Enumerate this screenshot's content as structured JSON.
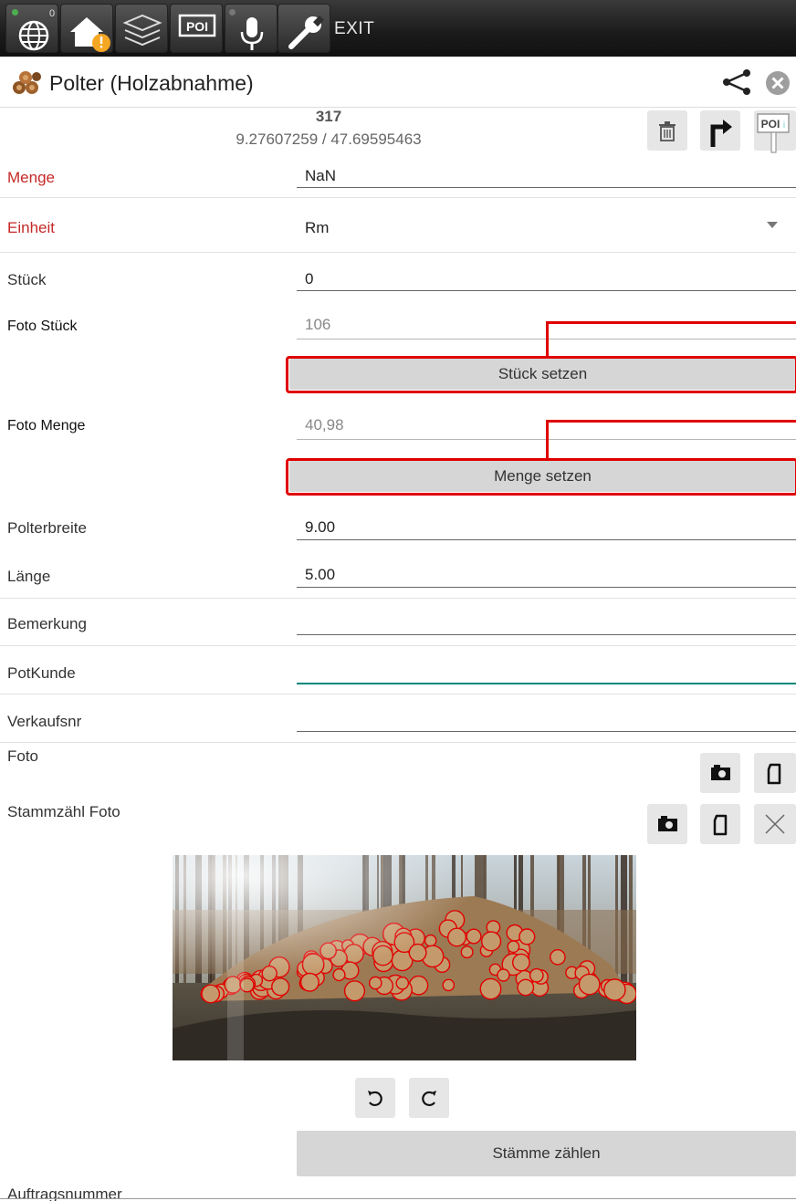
{
  "toolbar": {
    "exit_label": "EXIT",
    "gps_badge": "0",
    "items": [
      "globe-icon",
      "home-warning-icon",
      "layers-icon",
      "poi-icon",
      "microphone-icon",
      "wrench-icon"
    ]
  },
  "titlebar": {
    "title": "Polter (Holzabnahme)",
    "icons": [
      "share-icon",
      "close-circle-icon"
    ]
  },
  "header": {
    "id": "317",
    "coords": "9.27607259 / 47.69595463",
    "poi_label": "POI"
  },
  "fields": {
    "menge": {
      "label": "Menge",
      "value": "NaN"
    },
    "einheit": {
      "label": "Einheit",
      "value": "Rm"
    },
    "stueck": {
      "label": "Stück",
      "value": "0"
    },
    "foto_stueck": {
      "label": "Foto Stück",
      "value": "106",
      "button": "Stück setzen"
    },
    "foto_menge": {
      "label": "Foto Menge",
      "value": "40,98",
      "button": "Menge setzen"
    },
    "polterbreite": {
      "label": "Polterbreite",
      "value": "9.00"
    },
    "laenge": {
      "label": "Länge",
      "value": "5.00"
    },
    "bemerkung": {
      "label": "Bemerkung",
      "value": ""
    },
    "potkunde": {
      "label": "PotKunde",
      "value": ""
    },
    "verkaufsnr": {
      "label": "Verkaufsnr",
      "value": ""
    }
  },
  "foto": {
    "label": "Foto"
  },
  "stammzaehl": {
    "label": "Stammzähl Foto",
    "count_button": "Stämme zählen"
  },
  "auftragsnummer": {
    "label": "Auftragsnummer"
  },
  "colors": {
    "required_label": "#c62828",
    "annotation": "#e00000",
    "focus_line": "#00897b"
  }
}
